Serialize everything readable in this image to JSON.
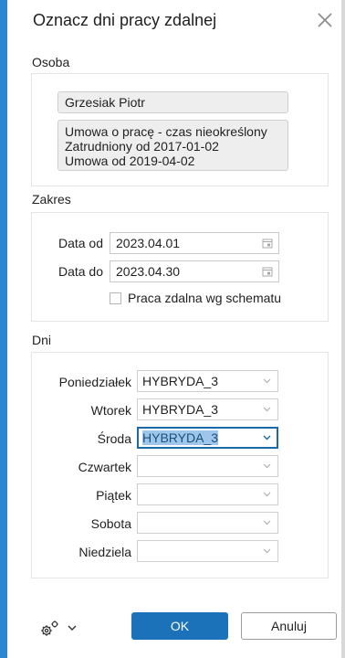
{
  "dialog": {
    "title": "Oznacz dni pracy zdalnej",
    "close_icon": "close-icon"
  },
  "osoba": {
    "section_label": "Osoba",
    "name": "Grzesiak Piotr",
    "contract_lines": [
      "Umowa o pracę - czas nieokreślony",
      "Zatrudniony od 2017-01-02",
      "Umowa od 2019-04-02"
    ]
  },
  "zakres": {
    "section_label": "Zakres",
    "date_from_label": "Data od",
    "date_from_value": "2023.04.01",
    "date_to_label": "Data do",
    "date_to_value": "2023.04.30",
    "calendar_icon": "calendar-icon",
    "checkbox_label": "Praca zdalna wg schematu",
    "checkbox_checked": false
  },
  "dni": {
    "section_label": "Dni",
    "days": [
      {
        "label": "Poniedziałek",
        "value": "HYBRYDA_3"
      },
      {
        "label": "Wtorek",
        "value": "HYBRYDA_3"
      },
      {
        "label": "Środa",
        "value": "HYBRYDA_3",
        "focused": true,
        "selected_text": true
      },
      {
        "label": "Czwartek",
        "value": ""
      },
      {
        "label": "Piątek",
        "value": ""
      },
      {
        "label": "Sobota",
        "value": ""
      },
      {
        "label": "Niedziela",
        "value": ""
      }
    ]
  },
  "footer": {
    "settings_icon": "gears-icon",
    "menu_icon": "chevron-down-icon",
    "ok_label": "OK",
    "cancel_label": "Anuluj"
  },
  "colors": {
    "accent": "#1b72b8",
    "focus_border": "#1b6aa8",
    "selection": "#9ec6ea"
  }
}
